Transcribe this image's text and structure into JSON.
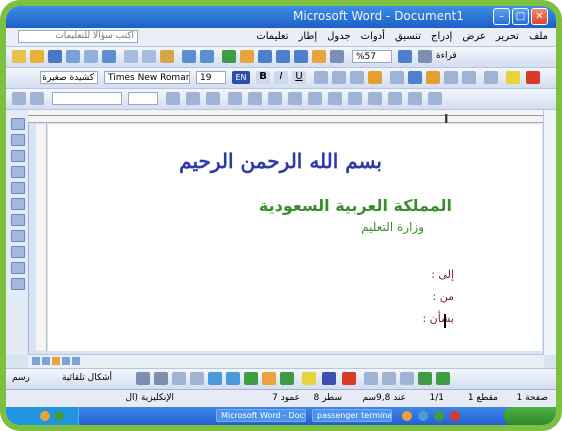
{
  "window": {
    "title": "Microsoft Word - Document1"
  },
  "menubar": {
    "items": [
      "ملف",
      "تحرير",
      "عرض",
      "إدراج",
      "تنسيق",
      "أدوات",
      "جدول",
      "إطار",
      "تعليمات"
    ],
    "help_placeholder": "اكتب سؤالا للتعليمات"
  },
  "toolbar": {
    "zoom": "%57",
    "read_label": "قراءة",
    "style_field": "كشيدة صغيرة",
    "font_field": "Times New Roman",
    "size_field": "19",
    "lang_badge": "EN"
  },
  "document": {
    "basmala": "بسم الله الرحمن الرحيم",
    "kingdom": "المملكة العربية السعودية",
    "ministry": "وزارة التعليم",
    "to_label": "إلى :",
    "from_label": "من :",
    "subject_label": "بشأن :"
  },
  "drawing_toolbar": {
    "draw_label": "رسم",
    "autoshapes_label": "أشكال تلقائية"
  },
  "statusbar": {
    "page": "صفحة 1",
    "section": "مقطع 1",
    "pages": "1/1",
    "position": "عند 9,8سم",
    "line": "سطر 8",
    "column": "عمود 7",
    "language": "الإنكليزية (ال"
  },
  "taskbar": {
    "task_word": "Microsoft Word - Docu...",
    "task_terminal": "passenger terminal"
  },
  "colors": {
    "frame": "#7dbf3f",
    "titlebar": "#2a70d8",
    "basmala": "#2f3aa6",
    "kingdom": "#3b8e2f",
    "fields": "#7a1d3f"
  }
}
